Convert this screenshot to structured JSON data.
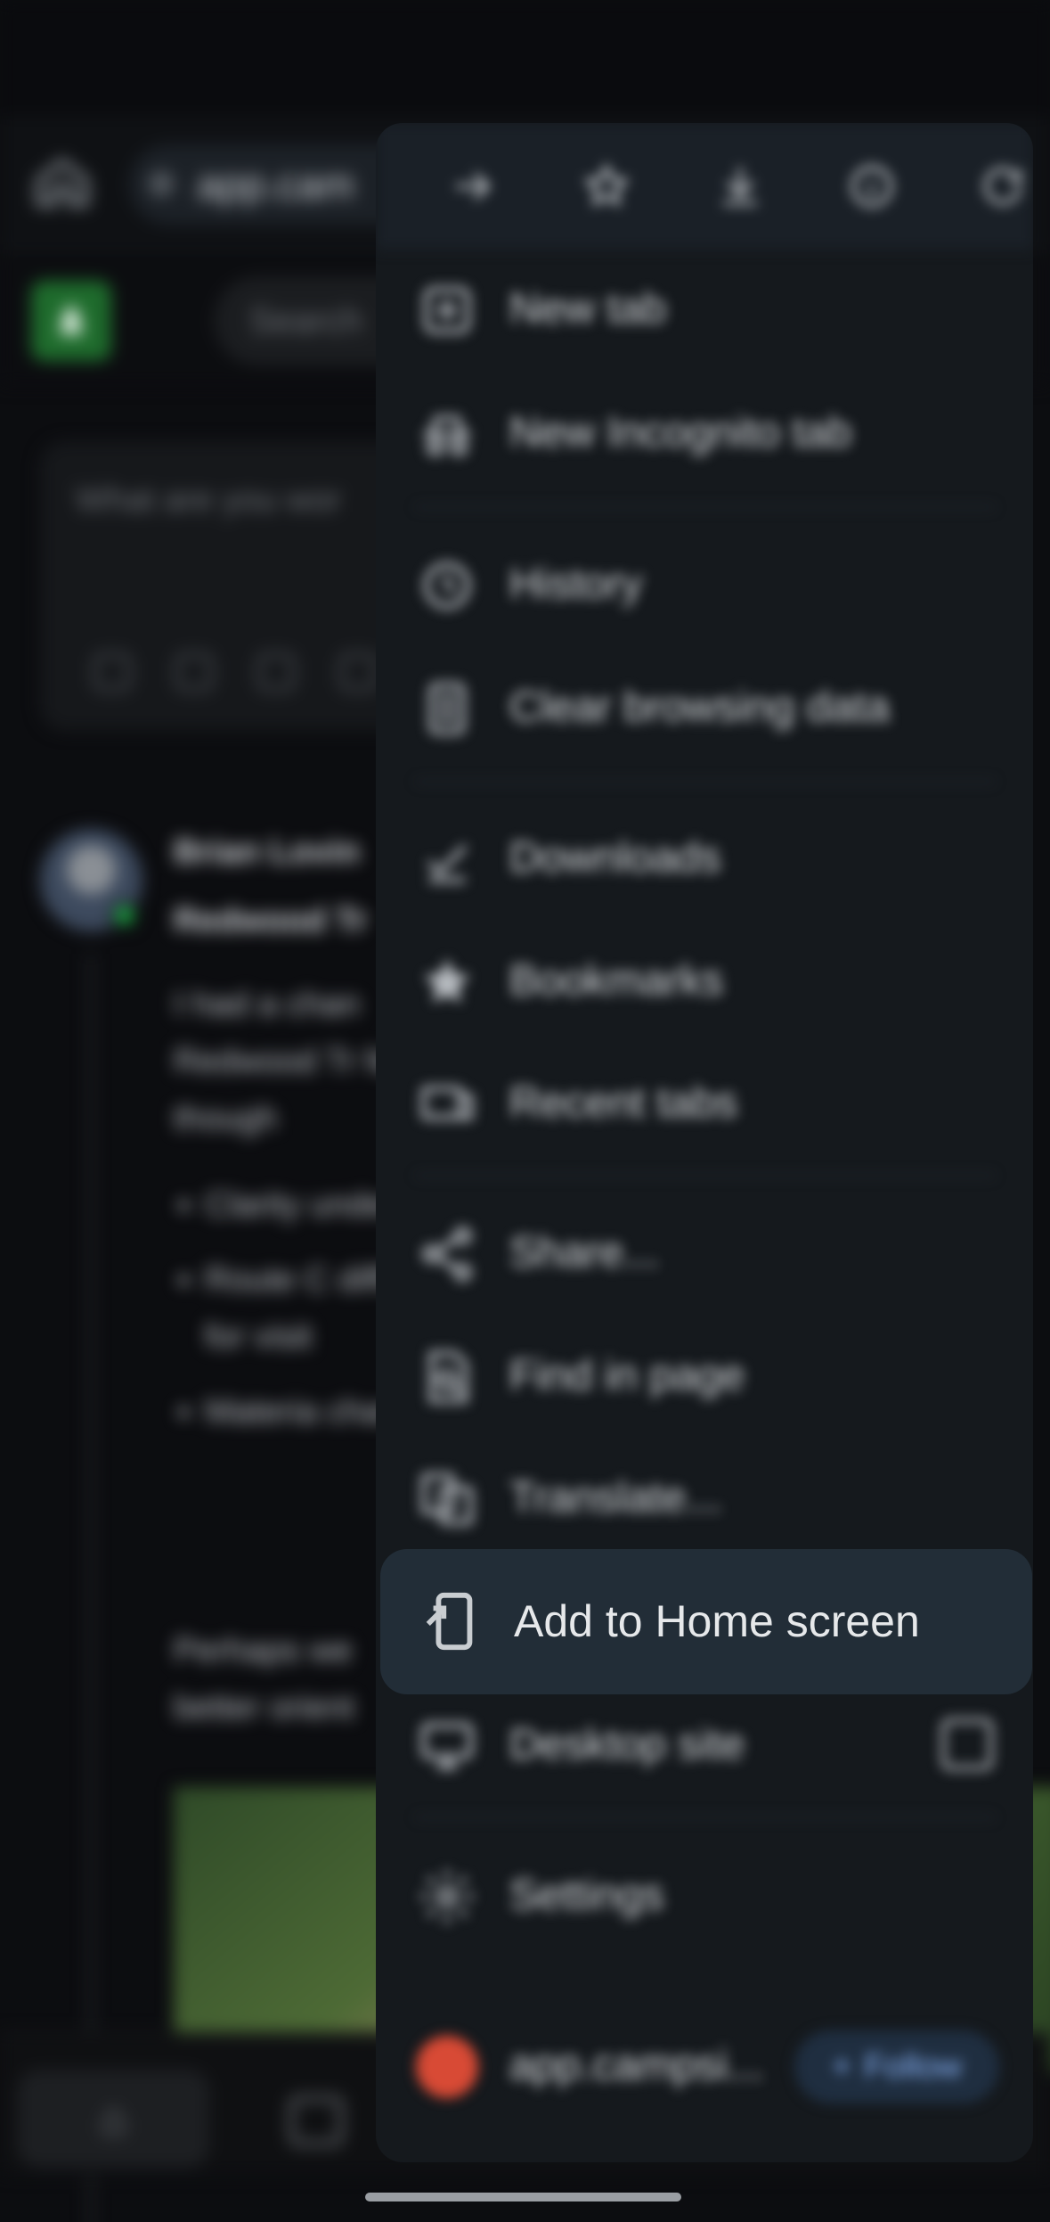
{
  "toolbar": {
    "url_text": "app.cam"
  },
  "app": {
    "search_placeholder": "Search",
    "composer_placeholder": "What are you wor"
  },
  "post": {
    "author": "Brian Lovin",
    "title": "Redwood Tr",
    "body": "I had a chan Redwood Tr few though",
    "bullets": [
      "Clarity underst",
      "Route C difficult for visit",
      "Materia change"
    ],
    "tail": "Perhaps we better orient"
  },
  "menu": {
    "top_icons": [
      "forward-icon",
      "star-icon",
      "download-icon",
      "info-icon",
      "refresh-icon"
    ],
    "items": [
      {
        "id": "new-tab",
        "label": "New tab",
        "icon": "new-tab-icon"
      },
      {
        "id": "new-incognito-tab",
        "label": "New Incognito tab",
        "icon": "incognito-icon"
      },
      {
        "id": "history",
        "label": "History",
        "icon": "history-icon"
      },
      {
        "id": "clear-browsing-data",
        "label": "Clear browsing data",
        "icon": "trash-icon"
      },
      {
        "id": "downloads",
        "label": "Downloads",
        "icon": "downloads-icon"
      },
      {
        "id": "bookmarks",
        "label": "Bookmarks",
        "icon": "bookmark-star-icon"
      },
      {
        "id": "recent-tabs",
        "label": "Recent tabs",
        "icon": "recent-tabs-icon"
      },
      {
        "id": "share",
        "label": "Share...",
        "icon": "share-icon"
      },
      {
        "id": "find-in-page",
        "label": "Find in page",
        "icon": "find-in-page-icon"
      },
      {
        "id": "translate",
        "label": "Translate...",
        "icon": "translate-icon"
      },
      {
        "id": "add-to-home-screen",
        "label": "Add to Home screen",
        "icon": "add-to-home-icon"
      },
      {
        "id": "desktop-site",
        "label": "Desktop site",
        "icon": "desktop-icon",
        "checked": false
      },
      {
        "id": "settings",
        "label": "Settings",
        "icon": "settings-gear-icon"
      }
    ],
    "site": {
      "name": "app.campsi...",
      "follow_label": "Follow"
    }
  }
}
